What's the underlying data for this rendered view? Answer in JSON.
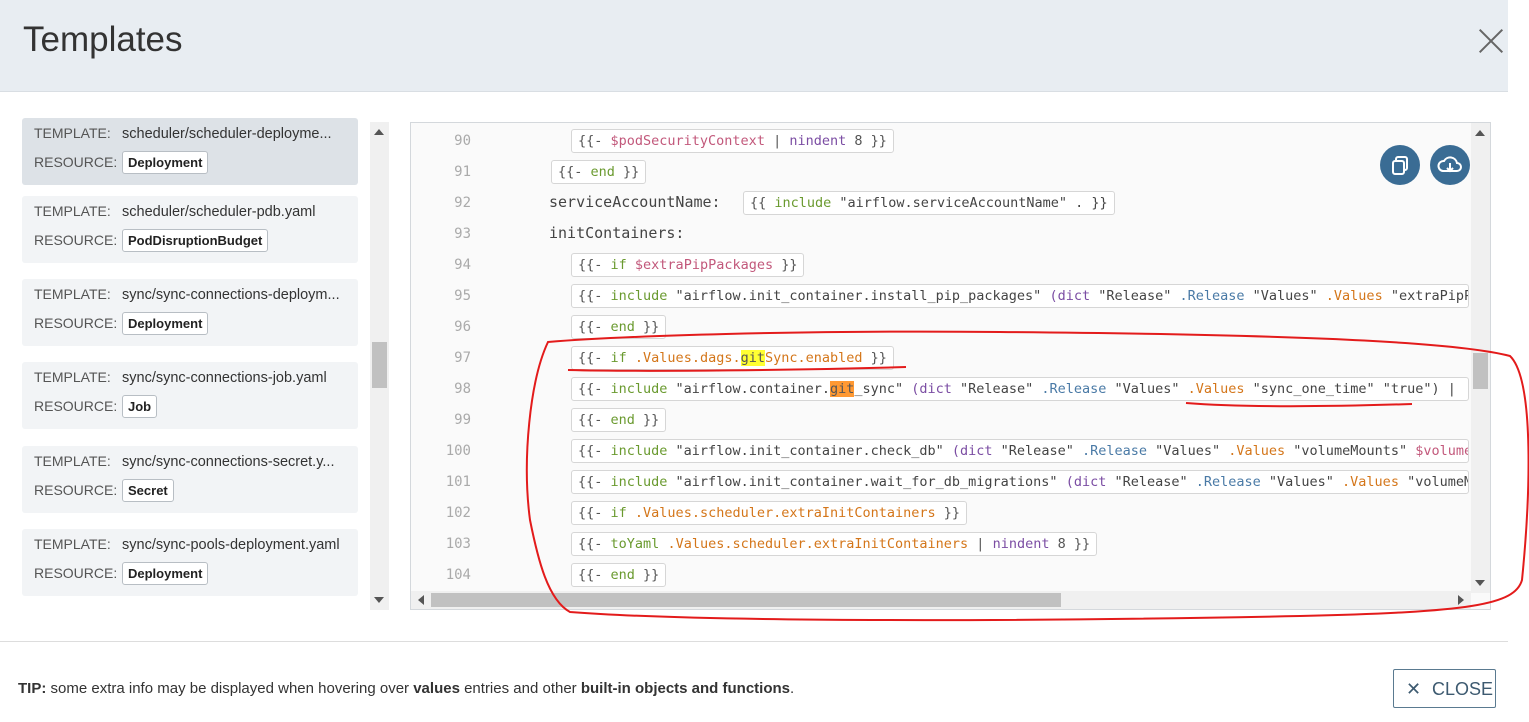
{
  "window": {
    "title": "Templates"
  },
  "sidebar": {
    "items": [
      {
        "template_key": "TEMPLATE:",
        "template": "scheduler/scheduler-deployme...",
        "resource_key": "RESOURCE:",
        "resource": "Deployment",
        "active": true
      },
      {
        "template_key": "TEMPLATE:",
        "template": "scheduler/scheduler-pdb.yaml",
        "resource_key": "RESOURCE:",
        "resource": "PodDisruptionBudget"
      },
      {
        "template_key": "TEMPLATE:",
        "template": "sync/sync-connections-deploym...",
        "resource_key": "RESOURCE:",
        "resource": "Deployment"
      },
      {
        "template_key": "TEMPLATE:",
        "template": "sync/sync-connections-job.yaml",
        "resource_key": "RESOURCE:",
        "resource": "Job"
      },
      {
        "template_key": "TEMPLATE:",
        "template": "sync/sync-connections-secret.y...",
        "resource_key": "RESOURCE:",
        "resource": "Secret"
      },
      {
        "template_key": "TEMPLATE:",
        "template": "sync/sync-pools-deployment.yaml",
        "resource_key": "RESOURCE:",
        "resource": "Deployment"
      }
    ]
  },
  "editor": {
    "lines": [
      {
        "n": "90",
        "tokens": [
          [
            "{{- ",
            ""
          ],
          [
            "$podSecurityContext",
            "var"
          ],
          [
            " | ",
            ""
          ],
          [
            "nindent",
            "fn"
          ],
          [
            " 8 }}",
            ""
          ]
        ]
      },
      {
        "n": "91",
        "tokens": [
          [
            "{{- ",
            ""
          ],
          [
            "end",
            "kw"
          ],
          [
            " }}",
            ""
          ]
        ]
      },
      {
        "n": "92",
        "text": "serviceAccountName:",
        "tokens": [
          [
            "{{ ",
            ""
          ],
          [
            "include",
            "kw"
          ],
          [
            " \"airflow.serviceAccountName\" . }}",
            "str"
          ]
        ]
      },
      {
        "n": "93",
        "text": "initContainers:"
      },
      {
        "n": "94",
        "tokens": [
          [
            "{{- ",
            ""
          ],
          [
            "if",
            "kw"
          ],
          [
            " ",
            ""
          ],
          [
            "$extraPipPackages",
            "var"
          ],
          [
            " }}",
            ""
          ]
        ]
      },
      {
        "n": "95",
        "tokens": [
          [
            "{{- ",
            ""
          ],
          [
            "include",
            "kw"
          ],
          [
            " \"airflow.init_container.install_pip_packages\" ",
            "str"
          ],
          [
            "(dict",
            "fn"
          ],
          [
            " \"Release\" ",
            "str"
          ],
          [
            ".Release",
            "obj"
          ],
          [
            " \"Values\" ",
            "str"
          ],
          [
            ".Values",
            "dot"
          ],
          [
            " \"extraPipP",
            "str"
          ]
        ]
      },
      {
        "n": "96",
        "tokens": [
          [
            "{{- ",
            ""
          ],
          [
            "end",
            "kw"
          ],
          [
            " }}",
            ""
          ]
        ]
      },
      {
        "n": "97",
        "tokens": [
          [
            "{{- ",
            ""
          ],
          [
            "if",
            "kw"
          ],
          [
            " ",
            ""
          ],
          [
            ".Values.dags.",
            "dot"
          ],
          [
            "git",
            "hl-yellow"
          ],
          [
            "Sync.enabled",
            "dot"
          ],
          [
            " }}",
            ""
          ]
        ]
      },
      {
        "n": "98",
        "tokens": [
          [
            "{{- ",
            ""
          ],
          [
            "include",
            "kw"
          ],
          [
            " \"airflow.container.",
            "str"
          ],
          [
            "git",
            "hl-orange"
          ],
          [
            "_sync\" ",
            "str"
          ],
          [
            "(dict",
            "fn"
          ],
          [
            " \"Release\" ",
            "str"
          ],
          [
            ".Release",
            "obj"
          ],
          [
            " \"Values\" ",
            "str"
          ],
          [
            ".Values",
            "dot"
          ],
          [
            " \"sync_one_time\" \"true\") | ",
            "str"
          ]
        ]
      },
      {
        "n": "99",
        "tokens": [
          [
            "{{- ",
            ""
          ],
          [
            "end",
            "kw"
          ],
          [
            " }}",
            ""
          ]
        ]
      },
      {
        "n": "100",
        "tokens": [
          [
            "{{- ",
            ""
          ],
          [
            "include",
            "kw"
          ],
          [
            " \"airflow.init_container.check_db\" ",
            "str"
          ],
          [
            "(dict",
            "fn"
          ],
          [
            " \"Release\" ",
            "str"
          ],
          [
            ".Release",
            "obj"
          ],
          [
            " \"Values\" ",
            "str"
          ],
          [
            ".Values",
            "dot"
          ],
          [
            " \"volumeMounts\" ",
            "str"
          ],
          [
            "$volume",
            "var"
          ]
        ]
      },
      {
        "n": "101",
        "tokens": [
          [
            "{{- ",
            ""
          ],
          [
            "include",
            "kw"
          ],
          [
            " \"airflow.init_container.wait_for_db_migrations\" ",
            "str"
          ],
          [
            "(dict",
            "fn"
          ],
          [
            " \"Release\" ",
            "str"
          ],
          [
            ".Release",
            "obj"
          ],
          [
            " \"Values\" ",
            "str"
          ],
          [
            ".Values",
            "dot"
          ],
          [
            " \"volumeM",
            "str"
          ]
        ]
      },
      {
        "n": "102",
        "tokens": [
          [
            "{{- ",
            ""
          ],
          [
            "if",
            "kw"
          ],
          [
            " ",
            ""
          ],
          [
            ".Values.scheduler.extraInitContainers",
            "dot"
          ],
          [
            " }}",
            ""
          ]
        ]
      },
      {
        "n": "103",
        "tokens": [
          [
            "{{- ",
            ""
          ],
          [
            "toYaml",
            "kw"
          ],
          [
            " ",
            ""
          ],
          [
            ".Values.scheduler.extraInitContainers",
            "dot"
          ],
          [
            " | ",
            ""
          ],
          [
            "nindent",
            "fn"
          ],
          [
            " 8 }}",
            ""
          ]
        ]
      },
      {
        "n": "104",
        "tokens": [
          [
            "{{- ",
            ""
          ],
          [
            "end",
            "kw"
          ],
          [
            " }}",
            ""
          ]
        ]
      }
    ]
  },
  "actions": {
    "copy_icon": "copy-icon",
    "download_icon": "cloud-download-icon"
  },
  "footer": {
    "tip_prefix": "TIP:",
    "tip_1": " some extra info may be displayed when hovering over ",
    "tip_values": "values",
    "tip_2": " entries and other ",
    "tip_builtin": "built-in objects and functions",
    "tip_end": ".",
    "close_icon": "✕",
    "close_label": "CLOSE"
  }
}
